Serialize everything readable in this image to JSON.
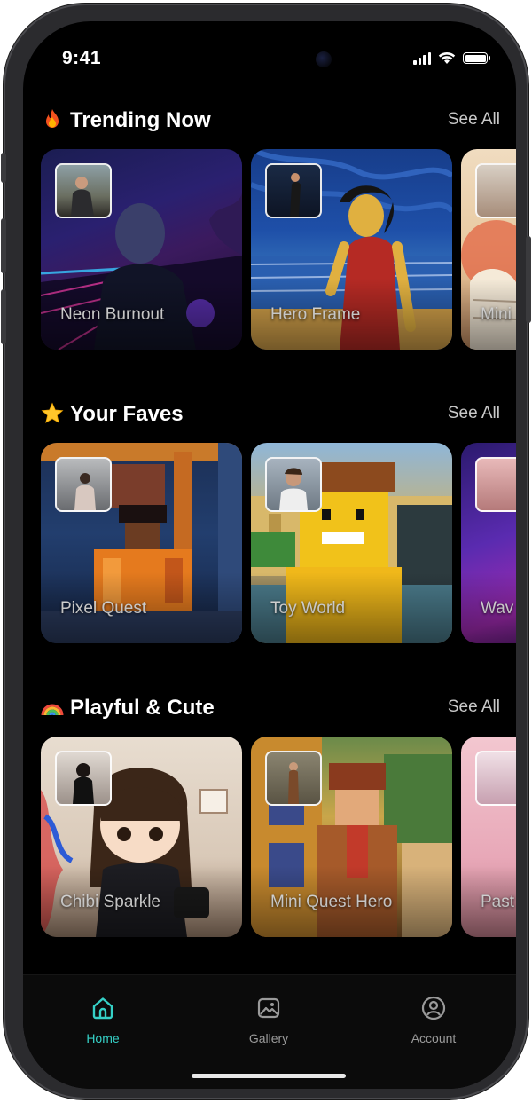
{
  "status_bar": {
    "time": "9:41"
  },
  "sections": [
    {
      "title": "Trending Now",
      "emoji": "fire-emoji",
      "see_all": "See All",
      "cards": [
        {
          "label": "Neon Burnout"
        },
        {
          "label": "Hero Frame"
        },
        {
          "label": "Mini"
        }
      ]
    },
    {
      "title": "Your Faves",
      "emoji": "star-emoji",
      "see_all": "See All",
      "cards": [
        {
          "label": "Pixel Quest"
        },
        {
          "label": "Toy World"
        },
        {
          "label": "Wav"
        }
      ]
    },
    {
      "title": "Playful & Cute",
      "emoji": "rainbow-emoji",
      "see_all": "See All",
      "cards": [
        {
          "label": "Chibi Sparkle"
        },
        {
          "label": "Mini Quest Hero"
        },
        {
          "label": "Past"
        }
      ]
    }
  ],
  "tab_bar": {
    "tabs": [
      {
        "label": "Home",
        "icon": "home-icon",
        "active": true
      },
      {
        "label": "Gallery",
        "icon": "gallery-icon",
        "active": false
      },
      {
        "label": "Account",
        "icon": "account-icon",
        "active": false
      }
    ]
  },
  "colors": {
    "accent": "#35d0c6",
    "background": "#000000"
  }
}
